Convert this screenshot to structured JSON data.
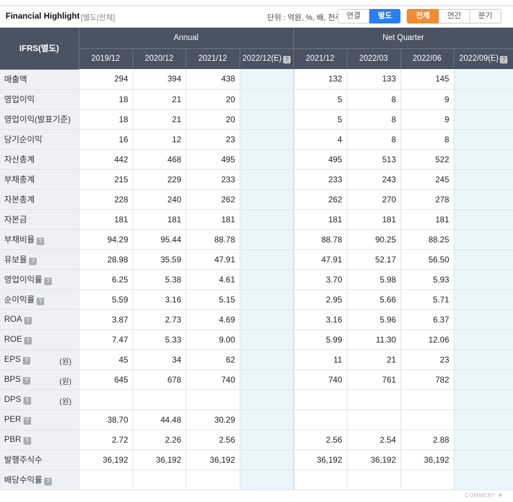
{
  "toolbar": {
    "title": "Financial Highlight",
    "scope": "[별도|전체]",
    "unit": "단위 : 억원, %, 배, 천주",
    "consolidated": "연결",
    "separate": "별도",
    "all": "전체",
    "annual": "연간",
    "quarter": "분기"
  },
  "header": {
    "corner": "IFRS(별도)",
    "annual_group": "Annual",
    "quarter_group": "Net Quarter",
    "periods": [
      "2019/12",
      "2020/12",
      "2021/12",
      "2022/12(E)",
      "2021/12",
      "2022/03",
      "2022/06",
      "2022/09(E)"
    ]
  },
  "rows": [
    {
      "label": "매출액",
      "values": [
        "294",
        "394",
        "438",
        "",
        "132",
        "133",
        "145",
        ""
      ]
    },
    {
      "label": "영업이익",
      "values": [
        "18",
        "21",
        "20",
        "",
        "5",
        "8",
        "9",
        ""
      ]
    },
    {
      "label": "영업이익(발표기준)",
      "values": [
        "18",
        "21",
        "20",
        "",
        "5",
        "8",
        "9",
        ""
      ]
    },
    {
      "label": "당기순이익",
      "values": [
        "16",
        "12",
        "23",
        "",
        "4",
        "8",
        "8",
        ""
      ]
    },
    {
      "label": "자산총계",
      "values": [
        "442",
        "468",
        "495",
        "",
        "495",
        "513",
        "522",
        ""
      ]
    },
    {
      "label": "부채총계",
      "values": [
        "215",
        "229",
        "233",
        "",
        "233",
        "243",
        "245",
        ""
      ]
    },
    {
      "label": "자본총계",
      "values": [
        "228",
        "240",
        "262",
        "",
        "262",
        "270",
        "278",
        ""
      ]
    },
    {
      "label": "자본금",
      "values": [
        "181",
        "181",
        "181",
        "",
        "181",
        "181",
        "181",
        ""
      ]
    },
    {
      "label": "부채비율",
      "values": [
        "94.29",
        "95.44",
        "88.78",
        "",
        "88.78",
        "90.25",
        "88.25",
        ""
      ]
    },
    {
      "label": "유보율",
      "values": [
        "28.98",
        "35.59",
        "47.91",
        "",
        "47.91",
        "52.17",
        "56.50",
        ""
      ]
    },
    {
      "label": "영업이익률",
      "values": [
        "6.25",
        "5.38",
        "4.61",
        "",
        "3.70",
        "5.98",
        "5.93",
        ""
      ]
    },
    {
      "label": "순이익률",
      "values": [
        "5.59",
        "3.16",
        "5.15",
        "",
        "2.95",
        "5.66",
        "5.71",
        ""
      ]
    },
    {
      "label": "ROA",
      "values": [
        "3.87",
        "2.73",
        "4.69",
        "",
        "3.16",
        "5.96",
        "6.37",
        ""
      ]
    },
    {
      "label": "ROE",
      "values": [
        "7.47",
        "5.33",
        "9.00",
        "",
        "5.99",
        "11.30",
        "12.06",
        ""
      ]
    },
    {
      "label": "EPS",
      "unit": "(원)",
      "values": [
        "45",
        "34",
        "62",
        "",
        "11",
        "21",
        "23",
        ""
      ]
    },
    {
      "label": "BPS",
      "unit": "(원)",
      "values": [
        "645",
        "678",
        "740",
        "",
        "740",
        "761",
        "782",
        ""
      ]
    },
    {
      "label": "DPS",
      "unit": "(원)",
      "values": [
        "",
        "",
        "",
        "",
        "",
        "",
        "",
        ""
      ]
    },
    {
      "label": "PER",
      "values": [
        "38.70",
        "44.48",
        "30.29",
        "",
        "",
        "",
        "",
        ""
      ]
    },
    {
      "label": "PBR",
      "values": [
        "2.72",
        "2.26",
        "2.56",
        "",
        "2.56",
        "2.54",
        "2.88",
        ""
      ]
    },
    {
      "label": "발행주식수",
      "values": [
        "36,192",
        "36,192",
        "36,192",
        "",
        "36,192",
        "36,192",
        "36,192",
        ""
      ]
    },
    {
      "label": "배당수익률",
      "values": [
        "",
        "",
        "",
        "",
        "",
        "",
        "",
        ""
      ]
    }
  ],
  "help_rows": [
    8,
    9,
    10,
    11,
    12,
    13,
    14,
    15,
    16,
    17,
    18,
    20
  ],
  "help_glyph": "?",
  "footer": {
    "comment": "COMMENT ▼"
  }
}
